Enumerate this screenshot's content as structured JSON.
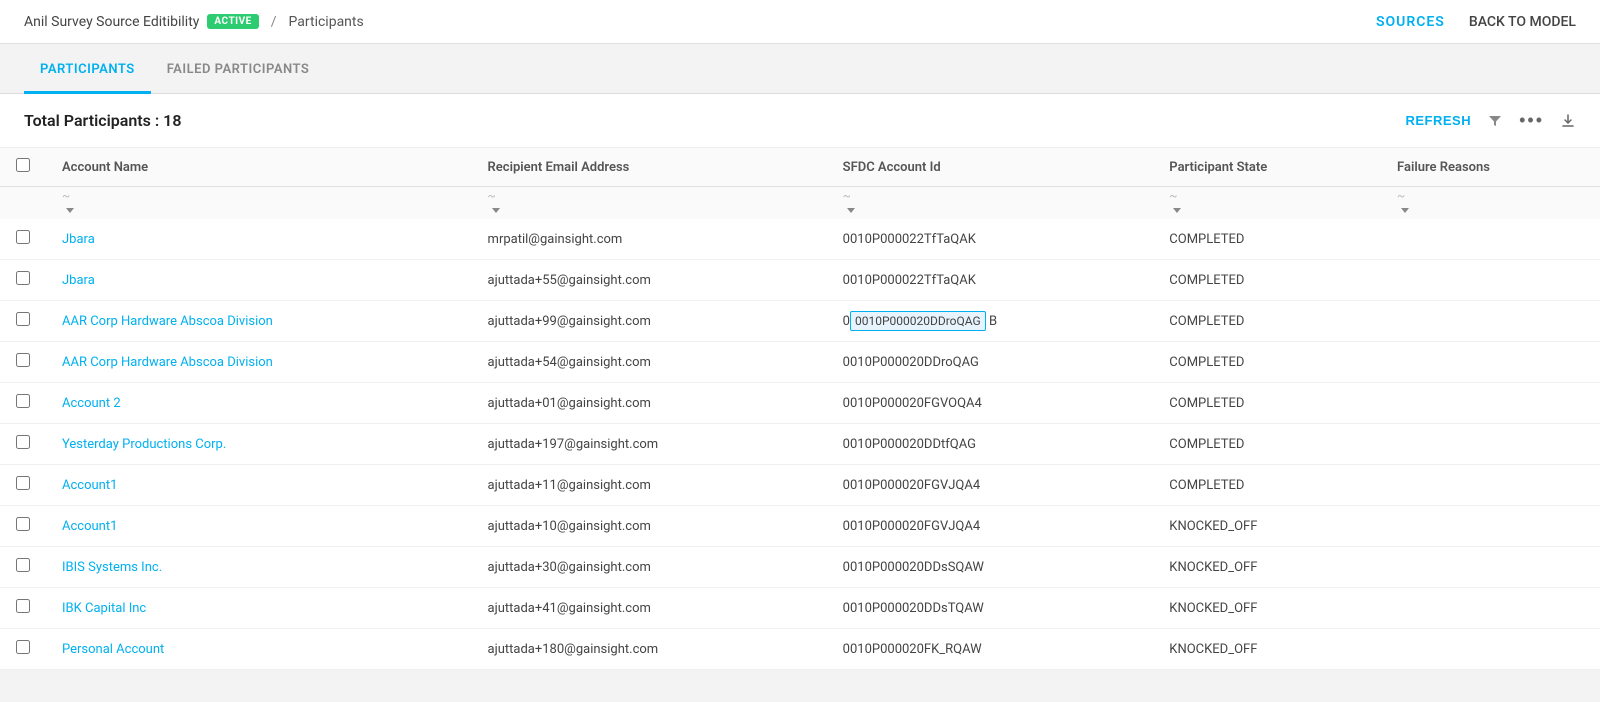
{
  "header": {
    "model_name": "Anil Survey Source Editibility",
    "active_badge": "ACTIVE",
    "breadcrumb_sep": "/",
    "breadcrumb_current": "Participants",
    "sources_label": "SOURCES",
    "back_to_model_label": "BACK TO MODEL"
  },
  "tabs": [
    {
      "id": "participants",
      "label": "PARTICIPANTS",
      "active": true
    },
    {
      "id": "failed_participants",
      "label": "FAILED PARTICIPANTS",
      "active": false
    }
  ],
  "toolbar": {
    "total_label": "Total Participants : 18",
    "refresh_label": "REFRESH"
  },
  "table": {
    "columns": [
      {
        "id": "checkbox",
        "label": ""
      },
      {
        "id": "account_name",
        "label": "Account Name"
      },
      {
        "id": "email",
        "label": "Recipient Email Address"
      },
      {
        "id": "sfdc_id",
        "label": "SFDC Account Id"
      },
      {
        "id": "state",
        "label": "Participant State"
      },
      {
        "id": "failure",
        "label": "Failure Reasons"
      }
    ],
    "rows": [
      {
        "account": "Jbara",
        "email": "mrpatil@gainsight.com",
        "sfdc_id": "0010P000022TfTaQAK",
        "state": "COMPLETED",
        "failure": "",
        "highlight": false
      },
      {
        "account": "Jbara",
        "email": "ajuttada+55@gainsight.com",
        "sfdc_id": "0010P000022TfTaQAK",
        "state": "COMPLETED",
        "failure": "",
        "highlight": false
      },
      {
        "account": "AAR Corp Hardware Abscoa Division",
        "email": "ajuttada+99@gainsight.com",
        "sfdc_id": "0010P000020DDroQAG",
        "state": "COMPLETED",
        "failure": "",
        "highlight": true
      },
      {
        "account": "AAR Corp Hardware Abscoa Division",
        "email": "ajuttada+54@gainsight.com",
        "sfdc_id": "0010P000020DDroQAG",
        "state": "COMPLETED",
        "failure": "",
        "highlight": false
      },
      {
        "account": "Account 2",
        "email": "ajuttada+01@gainsight.com",
        "sfdc_id": "0010P000020FGVOQA4",
        "state": "COMPLETED",
        "failure": "",
        "highlight": false
      },
      {
        "account": "Yesterday Productions Corp.",
        "email": "ajuttada+197@gainsight.com",
        "sfdc_id": "0010P000020DDtfQAG",
        "state": "COMPLETED",
        "failure": "",
        "highlight": false
      },
      {
        "account": "Account1",
        "email": "ajuttada+11@gainsight.com",
        "sfdc_id": "0010P000020FGVJQA4",
        "state": "COMPLETED",
        "failure": "",
        "highlight": false
      },
      {
        "account": "Account1",
        "email": "ajuttada+10@gainsight.com",
        "sfdc_id": "0010P000020FGVJQA4",
        "state": "KNOCKED_OFF",
        "failure": "",
        "highlight": false
      },
      {
        "account": "IBIS Systems Inc.",
        "email": "ajuttada+30@gainsight.com",
        "sfdc_id": "0010P000020DDsSQAW",
        "state": "KNOCKED_OFF",
        "failure": "",
        "highlight": false
      },
      {
        "account": "IBK Capital Inc",
        "email": "ajuttada+41@gainsight.com",
        "sfdc_id": "0010P000020DDsTQAW",
        "state": "KNOCKED_OFF",
        "failure": "",
        "highlight": false
      },
      {
        "account": "Personal Account",
        "email": "ajuttada+180@gainsight.com",
        "sfdc_id": "0010P000020FK_RQAW",
        "state": "KNOCKED_OFF",
        "failure": "",
        "highlight": false
      }
    ]
  }
}
